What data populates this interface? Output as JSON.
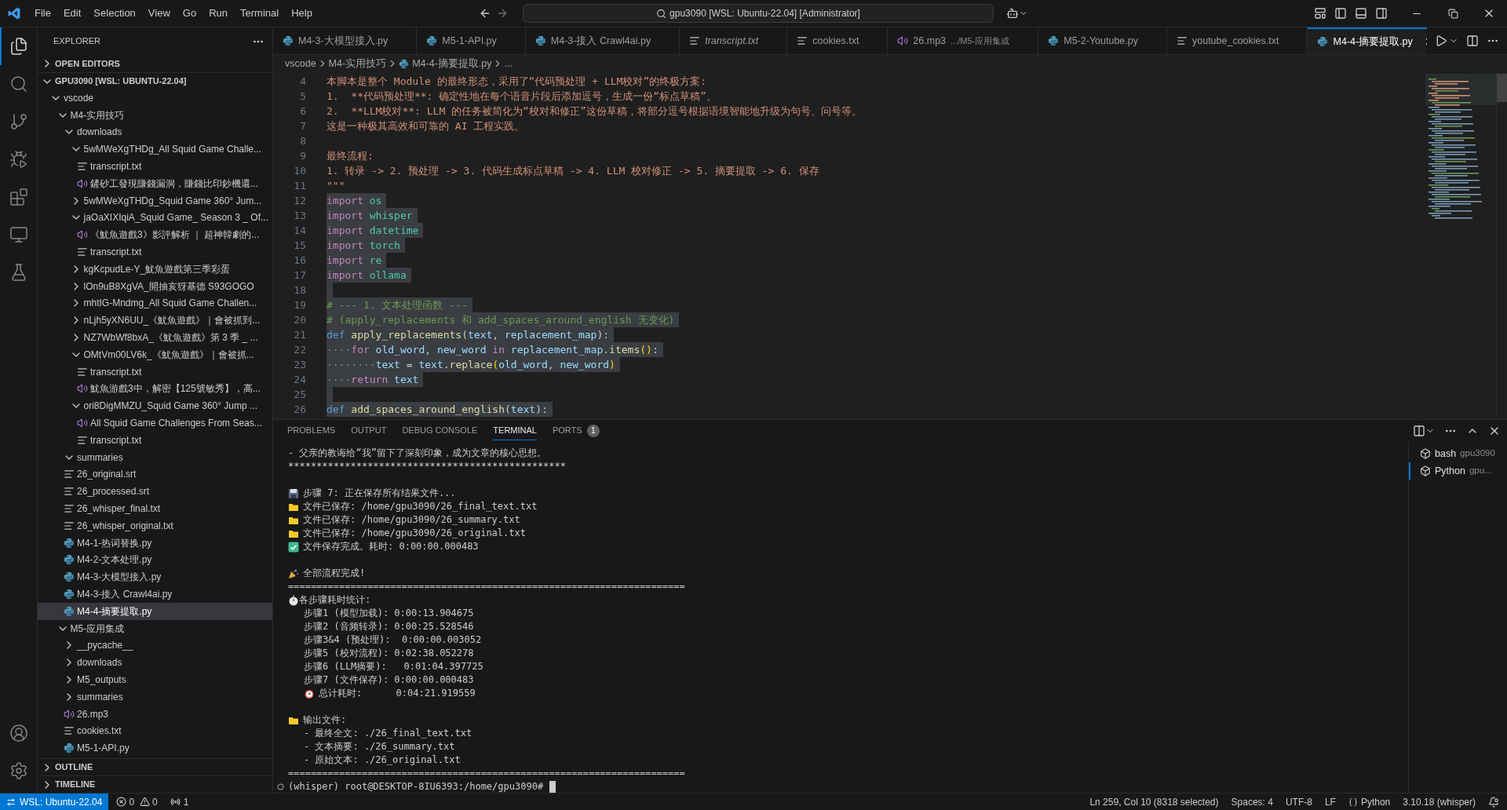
{
  "title_bar": {
    "menu": [
      "File",
      "Edit",
      "Selection",
      "View",
      "Go",
      "Run",
      "Terminal",
      "Help"
    ],
    "command_center": "gpu3090 [WSL: Ubuntu-22.04] [Administrator]"
  },
  "activity_bar": {
    "top": [
      {
        "kind": "explorer",
        "selected": true
      },
      {
        "kind": "search",
        "selected": false
      },
      {
        "kind": "source_control",
        "selected": false
      },
      {
        "kind": "run",
        "selected": false
      },
      {
        "kind": "extensions",
        "selected": false
      },
      {
        "kind": "remote",
        "selected": false
      },
      {
        "kind": "testing",
        "selected": false
      }
    ],
    "bottom": [
      {
        "kind": "accounts",
        "selected": false
      },
      {
        "kind": "manage",
        "selected": false
      }
    ]
  },
  "sidebar": {
    "title": "EXPLORER",
    "open_editors": {
      "label": "OPEN EDITORS",
      "expanded": false
    },
    "workspace": {
      "label": "GPU3090 [WSL: UBUNTU-22.04]",
      "expanded": true,
      "items": [
        {
          "label": "vscode",
          "kind": "folder",
          "expanded": true,
          "selected": false,
          "children": [
            {
              "label": "M4-实用技巧",
              "kind": "folder",
              "expanded": true,
              "selected": false,
              "children": [
                {
                  "label": "downloads",
                  "kind": "folder",
                  "expanded": true,
                  "selected": false,
                  "children": [
                    {
                      "label": "5wMWeXgTHDg_All Squid Game Challe...",
                      "kind": "folder",
                      "expanded": true,
                      "selected": false,
                      "children": [
                        {
                          "label": "transcript.txt",
                          "kind": "text",
                          "selected": false
                        },
                        {
                          "label": "鏟砂工發現賺錢漏洞，賺錢比印鈔機還...",
                          "kind": "audio",
                          "selected": false
                        }
                      ]
                    },
                    {
                      "label": "5wMWeXgTHDg_Squid Game 360° Jum...",
                      "kind": "folder",
                      "expanded": false,
                      "selected": false
                    },
                    {
                      "label": "jaOaXIXIqiA_Squid Game_ Season 3 _ Of...",
                      "kind": "folder",
                      "expanded": true,
                      "selected": false,
                      "children": [
                        {
                          "label": "《魷魚遊戲3》影評解析 ｜ 超神韓劇的...",
                          "kind": "audio",
                          "selected": false
                        },
                        {
                          "label": "transcript.txt",
                          "kind": "text",
                          "selected": false
                        }
                      ]
                    },
                    {
                      "label": "kgKcpudLe-Y_魷魚遊戲第三季彩蛋",
                      "kind": "folder",
                      "expanded": false,
                      "selected": false
                    },
                    {
                      "label": "lOn9uB8XgVA_開抽亥犽基德 S93GOGO",
                      "kind": "folder",
                      "expanded": false,
                      "selected": false
                    },
                    {
                      "label": "mhtIG-Mndmg_All Squid Game Challen...",
                      "kind": "folder",
                      "expanded": false,
                      "selected": false
                    },
                    {
                      "label": "nLjh5yXN6UU_《魷魚遊戲》｜會被抓到...",
                      "kind": "folder",
                      "expanded": false,
                      "selected": false
                    },
                    {
                      "label": "NZ7WbWf8bxA_《魷魚遊戲》第 3 季 _ ...",
                      "kind": "folder",
                      "expanded": false,
                      "selected": false
                    },
                    {
                      "label": "OMtVm00LV6k_《魷魚遊戲》｜會被抓...",
                      "kind": "folder",
                      "expanded": true,
                      "selected": false,
                      "children": [
                        {
                          "label": "transcript.txt",
                          "kind": "text",
                          "selected": false
                        },
                        {
                          "label": "魷魚游戲3中，解密【125號敏秀】，高...",
                          "kind": "audio",
                          "selected": false
                        }
                      ]
                    },
                    {
                      "label": "ori8DigMMZU_Squid Game 360° Jump ...",
                      "kind": "folder",
                      "expanded": true,
                      "selected": false,
                      "children": [
                        {
                          "label": "All Squid Game Challenges From Seas...",
                          "kind": "audio",
                          "selected": false
                        },
                        {
                          "label": "transcript.txt",
                          "kind": "text",
                          "selected": false
                        }
                      ]
                    }
                  ]
                },
                {
                  "label": "summaries",
                  "kind": "folder",
                  "expanded": true,
                  "selected": false
                },
                {
                  "label": "26_original.srt",
                  "kind": "text",
                  "selected": false
                },
                {
                  "label": "26_processed.srt",
                  "kind": "text",
                  "selected": false
                },
                {
                  "label": "26_whisper_final.txt",
                  "kind": "text",
                  "selected": false
                },
                {
                  "label": "26_whisper_original.txt",
                  "kind": "text",
                  "selected": false
                },
                {
                  "label": "M4-1-热词替换.py",
                  "kind": "python",
                  "selected": false
                },
                {
                  "label": "M4-2-文本处理.py",
                  "kind": "python",
                  "selected": false
                },
                {
                  "label": "M4-3-大模型接入.py",
                  "kind": "python",
                  "selected": false
                },
                {
                  "label": "M4-3-接入 Crawl4ai.py",
                  "kind": "python",
                  "selected": false
                },
                {
                  "label": "M4-4-摘要提取.py",
                  "kind": "python",
                  "selected": true
                }
              ]
            },
            {
              "label": "M5-应用集成",
              "kind": "folder",
              "expanded": true,
              "selected": false,
              "children": [
                {
                  "label": "__pycache__",
                  "kind": "folder",
                  "expanded": false,
                  "selected": false
                },
                {
                  "label": "downloads",
                  "kind": "folder",
                  "expanded": false,
                  "selected": false
                },
                {
                  "label": "M5_outputs",
                  "kind": "folder",
                  "expanded": false,
                  "selected": false
                },
                {
                  "label": "summaries",
                  "kind": "folder",
                  "expanded": false,
                  "selected": false
                },
                {
                  "label": "26.mp3",
                  "kind": "audio",
                  "selected": false
                },
                {
                  "label": "cookies.txt",
                  "kind": "text",
                  "selected": false
                },
                {
                  "label": "M5-1-API.py",
                  "kind": "python",
                  "selected": false
                }
              ]
            }
          ]
        }
      ]
    },
    "outline": {
      "label": "OUTLINE",
      "expanded": false
    },
    "timeline": {
      "label": "TIMELINE",
      "expanded": false
    }
  },
  "tabs": [
    {
      "label": "M4-3-大模型接入.py",
      "kind": "python",
      "preview": false,
      "selected": false
    },
    {
      "label": "M5-1-API.py",
      "kind": "python",
      "preview": false,
      "selected": false
    },
    {
      "label": "M4-3-接入 Crawl4ai.py",
      "kind": "python",
      "preview": false,
      "selected": false
    },
    {
      "label": "transcript.txt",
      "kind": "text",
      "preview": true,
      "selected": false
    },
    {
      "label": "cookies.txt",
      "kind": "text",
      "preview": false,
      "selected": false
    },
    {
      "label": "26.mp3",
      "detail": ".../M5-应用集成",
      "kind": "audio",
      "preview": false,
      "selected": false
    },
    {
      "label": "M5-2-Youtube.py",
      "kind": "python",
      "preview": false,
      "selected": false
    },
    {
      "label": "youtube_cookies.txt",
      "kind": "text",
      "preview": false,
      "selected": false
    },
    {
      "label": "M4-4-摘要提取.py",
      "kind": "python",
      "preview": false,
      "selected": true
    }
  ],
  "breadcrumb": [
    {
      "label": "vscode",
      "kind": "folder"
    },
    {
      "label": "M4-实用技巧",
      "kind": "folder"
    },
    {
      "label": "M4-4-摘要提取.py",
      "kind": "python"
    },
    {
      "label": "...",
      "kind": "more"
    }
  ],
  "editor": {
    "lines": [
      {
        "number": "4",
        "selected": false,
        "tokens": [
          {
            "kind": "string",
            "text": "本脚本是整个 Module 的最终形态，采用了“代码预处理 + LLM校对”的终极方案:"
          }
        ]
      },
      {
        "number": "5",
        "selected": false,
        "tokens": [
          {
            "kind": "string",
            "text": "1.  **代码预处理**: 确定性地在每个语音片段后添加逗号，生成一份“标点草稿”。"
          }
        ]
      },
      {
        "number": "6",
        "selected": false,
        "tokens": [
          {
            "kind": "string",
            "text": "2.  **LLM校对**: LLM 的任务被简化为“校对和修正”这份草稿，将部分逗号根据语境智能地升级为句号、问号等。"
          }
        ]
      },
      {
        "number": "7",
        "selected": false,
        "tokens": [
          {
            "kind": "string",
            "text": "这是一种极其高效和可靠的 AI 工程实践。"
          }
        ]
      },
      {
        "number": "8",
        "selected": false
      },
      {
        "number": "9",
        "selected": false,
        "tokens": [
          {
            "kind": "string",
            "text": "最终流程:"
          }
        ]
      },
      {
        "number": "10",
        "selected": false,
        "tokens": [
          {
            "kind": "string",
            "text": "1. 转录 -> 2. 预处理 -> 3. 代码生成标点草稿 -> 4. LLM 校对修正 -> 5. 摘要提取 -> 6. 保存"
          }
        ]
      },
      {
        "number": "11",
        "selected": false,
        "tokens": [
          {
            "kind": "string",
            "text": "\"\"\""
          }
        ]
      },
      {
        "number": "12",
        "selected": true,
        "tokens": [
          {
            "kind": "keyword",
            "text": "import"
          },
          {
            "kind": "module",
            "text": " os"
          }
        ]
      },
      {
        "number": "13",
        "selected": true,
        "tokens": [
          {
            "kind": "keyword",
            "text": "import"
          },
          {
            "kind": "module",
            "text": " whisper"
          }
        ]
      },
      {
        "number": "14",
        "selected": true,
        "tokens": [
          {
            "kind": "keyword",
            "text": "import"
          },
          {
            "kind": "module",
            "text": " datetime"
          }
        ]
      },
      {
        "number": "15",
        "selected": true,
        "tokens": [
          {
            "kind": "keyword",
            "text": "import"
          },
          {
            "kind": "module",
            "text": " torch"
          }
        ]
      },
      {
        "number": "16",
        "selected": true,
        "tokens": [
          {
            "kind": "keyword",
            "text": "import"
          },
          {
            "kind": "module",
            "text": " re"
          }
        ]
      },
      {
        "number": "17",
        "selected": true,
        "tokens": [
          {
            "kind": "keyword",
            "text": "import"
          },
          {
            "kind": "module",
            "text": " ollama"
          }
        ]
      },
      {
        "number": "18",
        "selected": true
      },
      {
        "number": "19",
        "selected": true,
        "tokens": [
          {
            "kind": "comment",
            "text": "# --- 1. 文本处理函数 ---"
          }
        ]
      },
      {
        "number": "20",
        "selected": true,
        "tokens": [
          {
            "kind": "comment",
            "text": "# (apply_replacements 和 add_spaces_around_english 无变化)"
          }
        ]
      },
      {
        "number": "21",
        "selected": true,
        "tokens": [
          {
            "kind": "storage",
            "text": "def"
          },
          {
            "kind": "function",
            "text": " apply_replacements"
          },
          {
            "kind": "plain",
            "text": "("
          },
          {
            "kind": "variable",
            "text": "text"
          },
          {
            "kind": "plain",
            "text": ", "
          },
          {
            "kind": "variable",
            "text": "replacement_map"
          },
          {
            "kind": "plain",
            "text": "):"
          }
        ]
      },
      {
        "number": "22",
        "selected": true,
        "tokens": [
          {
            "kind": "whitespace",
            "text": "····"
          },
          {
            "kind": "keyword",
            "text": "for"
          },
          {
            "kind": "variable",
            "text": " old_word"
          },
          {
            "kind": "plain",
            "text": ", "
          },
          {
            "kind": "variable",
            "text": "new_word"
          },
          {
            "kind": "keyword",
            "text": " in"
          },
          {
            "kind": "variable",
            "text": " replacement_map"
          },
          {
            "kind": "plain",
            "text": "."
          },
          {
            "kind": "function",
            "text": "items"
          },
          {
            "kind": "paren",
            "text": "()"
          },
          {
            "kind": "plain",
            "text": ":"
          }
        ]
      },
      {
        "number": "23",
        "selected": true,
        "tokens": [
          {
            "kind": "whitespace",
            "text": "········"
          },
          {
            "kind": "variable",
            "text": "text"
          },
          {
            "kind": "plain",
            "text": " = "
          },
          {
            "kind": "variable",
            "text": "text"
          },
          {
            "kind": "plain",
            "text": "."
          },
          {
            "kind": "function",
            "text": "replace"
          },
          {
            "kind": "paren",
            "text": "("
          },
          {
            "kind": "variable",
            "text": "old_word"
          },
          {
            "kind": "plain",
            "text": ", "
          },
          {
            "kind": "variable",
            "text": "new_word"
          },
          {
            "kind": "paren",
            "text": ")"
          }
        ]
      },
      {
        "number": "24",
        "selected": true,
        "tokens": [
          {
            "kind": "whitespace",
            "text": "····"
          },
          {
            "kind": "keyword",
            "text": "return"
          },
          {
            "kind": "variable",
            "text": " text"
          }
        ]
      },
      {
        "number": "25",
        "selected": true
      },
      {
        "number": "26",
        "selected": true,
        "tokens": [
          {
            "kind": "storage",
            "text": "def"
          },
          {
            "kind": "function",
            "text": " add_spaces_around_english"
          },
          {
            "kind": "plain",
            "text": "("
          },
          {
            "kind": "variable",
            "text": "text"
          },
          {
            "kind": "plain",
            "text": "):"
          }
        ]
      }
    ]
  },
  "panel": {
    "tabs": [
      {
        "label": "PROBLEMS",
        "selected": false
      },
      {
        "label": "OUTPUT",
        "selected": false
      },
      {
        "label": "DEBUG CONSOLE",
        "selected": false
      },
      {
        "label": "TERMINAL",
        "selected": true
      },
      {
        "label": "PORTS",
        "badge": "1",
        "selected": false
      }
    ],
    "terminal": {
      "lines": [
        {
          "kind": "text",
          "text": "- 父亲的教诲给“我”留下了深刻印象，成为文章的核心思想。"
        },
        {
          "kind": "text",
          "text": "*************************************************"
        },
        {
          "kind": "blank"
        },
        {
          "kind": "save_step",
          "text": "步骤 7: 正在保存所有结果文件..."
        },
        {
          "kind": "file_saved",
          "text": "文件已保存: /home/gpu3090/26_final_text.txt"
        },
        {
          "kind": "file_saved",
          "text": "文件已保存: /home/gpu3090/26_summary.txt"
        },
        {
          "kind": "file_saved",
          "text": "文件已保存: /home/gpu3090/26_original.txt"
        },
        {
          "kind": "save_done",
          "text": "文件保存完成。耗时: 0:00:00.000483"
        },
        {
          "kind": "blank"
        },
        {
          "kind": "complete",
          "text": "全部流程完成!"
        },
        {
          "kind": "text",
          "text": "======================================================================"
        },
        {
          "kind": "stats",
          "text": "各步骤耗时统计:"
        },
        {
          "kind": "text",
          "indented": true,
          "text": "步骤1 (模型加载): 0:00:13.904675"
        },
        {
          "kind": "text",
          "indented": true,
          "text": "步骤2 (音频转录): 0:00:25.528546"
        },
        {
          "kind": "text",
          "indented": true,
          "text": "步骤3&4 (预处理):  0:00:00.003052"
        },
        {
          "kind": "text",
          "indented": true,
          "text": "步骤5 (校对流程): 0:02:38.052278"
        },
        {
          "kind": "text",
          "indented": true,
          "text": "步骤6 (LLM摘要):   0:01:04.397725"
        },
        {
          "kind": "text",
          "indented": true,
          "text": "步骤7 (文件保存): 0:00:00.000483"
        },
        {
          "kind": "total",
          "indented": true,
          "text": "总计耗时:      0:04:21.919559"
        },
        {
          "kind": "blank"
        },
        {
          "kind": "outputs",
          "text": "输出文件:"
        },
        {
          "kind": "text",
          "indented": true,
          "text": "- 最终全文: ./26_final_text.txt"
        },
        {
          "kind": "text",
          "indented": true,
          "text": "- 文本摘要: ./26_summary.txt"
        },
        {
          "kind": "text",
          "indented": true,
          "text": "- 原始文本: ./26_original.txt"
        },
        {
          "kind": "text",
          "text": "======================================================================"
        }
      ],
      "prompt": "(whisper) root@DESKTOP-8IU6393:/home/gpu3090#"
    },
    "sessions": [
      {
        "name": "bash",
        "detail": "gpu3090",
        "selected": false
      },
      {
        "name": "Python",
        "detail": "gpu...",
        "selected": true
      }
    ]
  },
  "status_bar": {
    "remote": "WSL: Ubuntu-22.04",
    "errors": "0",
    "warnings": "0",
    "ports": "1",
    "items": [
      "Ln 259, Col 10 (8318 selected)",
      "Spaces: 4",
      "UTF-8",
      "LF"
    ],
    "language": "Python",
    "interpreter": "3.10.18 (whisper)"
  }
}
